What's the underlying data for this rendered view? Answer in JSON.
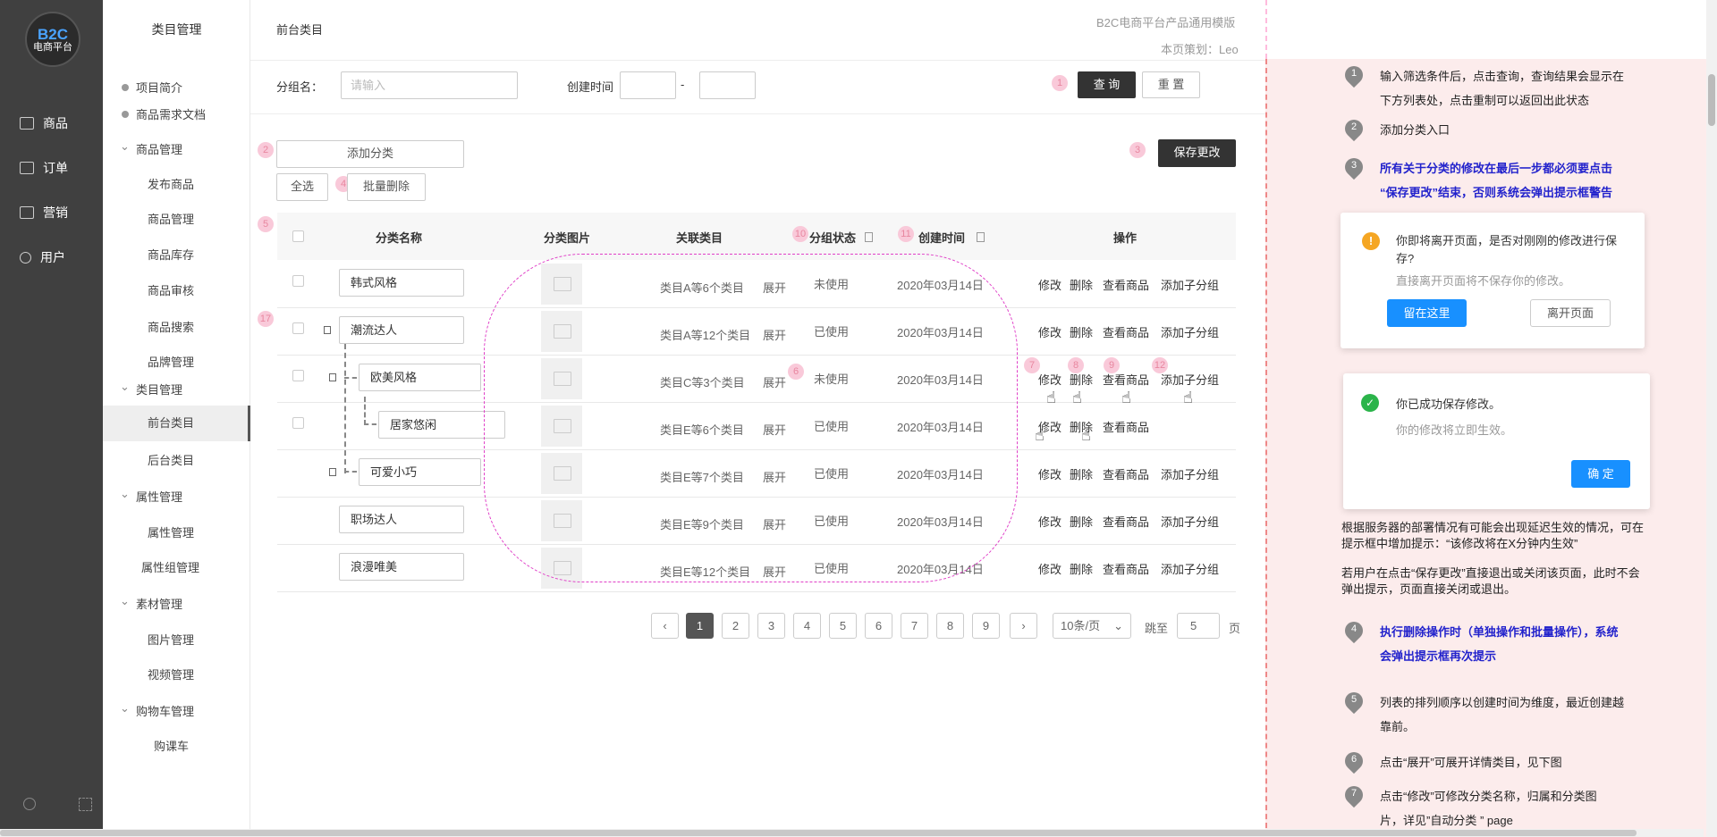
{
  "app": {
    "logo_top": "B2C",
    "logo_bottom": "电商平台"
  },
  "dark_nav": [
    {
      "label": "商品",
      "icon": "shopping-bag-icon"
    },
    {
      "label": "订单",
      "icon": "clipboard-icon"
    },
    {
      "label": "营销",
      "icon": "ticket-icon"
    },
    {
      "label": "用户",
      "icon": "user-icon"
    }
  ],
  "sidebar": {
    "title": "类目管理",
    "items": [
      {
        "label": "项目简介"
      },
      {
        "label": "商品需求文档"
      },
      {
        "label": "商品管理"
      },
      {
        "label": "发布商品"
      },
      {
        "label": "商品管理"
      },
      {
        "label": "商品库存"
      },
      {
        "label": "商品审核"
      },
      {
        "label": "商品搜索"
      },
      {
        "label": "品牌管理"
      },
      {
        "label": "类目管理"
      },
      {
        "label": "前台类目"
      },
      {
        "label": "后台类目"
      },
      {
        "label": "属性管理"
      },
      {
        "label": "属性管理"
      },
      {
        "label": "属性组管理"
      },
      {
        "label": "素材管理"
      },
      {
        "label": "图片管理"
      },
      {
        "label": "视频管理"
      },
      {
        "label": "购物车管理"
      },
      {
        "label": "购课车"
      }
    ]
  },
  "header": {
    "breadcrumb": "前台类目",
    "template": "B2C电商平台产品通用模版",
    "author": "本页策划：Leo"
  },
  "filter": {
    "group_label": "分组名：",
    "group_placeholder": "请输入",
    "time_label": "创建时间",
    "time_sep": "-",
    "query": "查 询",
    "reset": "重 置"
  },
  "actions": {
    "add": "添加分类",
    "save": "保存更改",
    "select_all": "全选",
    "batch_delete": "批量删除"
  },
  "table": {
    "headers": {
      "name": "分类名称",
      "image": "分类图片",
      "related": "关联类目",
      "status": "分组状态",
      "created": "创建时间",
      "ops": "操作"
    },
    "expand": "展开",
    "rows": [
      {
        "name": "韩式风格",
        "related": "类目A等6个类目",
        "status": "未使用",
        "created": "2020年03月14日"
      },
      {
        "name": "潮流达人",
        "related": "类目A等12个类目",
        "status": "已使用",
        "created": "2020年03月14日"
      },
      {
        "name": "欧美风格",
        "related": "类目C等3个类目",
        "status": "未使用",
        "created": "2020年03月14日"
      },
      {
        "name": "居家悠闲",
        "related": "类目E等6个类目",
        "status": "已使用",
        "created": "2020年03月14日"
      },
      {
        "name": "可爱小巧",
        "related": "类目E等7个类目",
        "status": "已使用",
        "created": "2020年03月14日"
      },
      {
        "name": "职场达人",
        "related": "类目E等9个类目",
        "status": "已使用",
        "created": "2020年03月14日"
      },
      {
        "name": "浪漫唯美",
        "related": "类目E等12个类目",
        "status": "已使用",
        "created": "2020年03月14日"
      }
    ],
    "ops": {
      "edit": "修改",
      "delete": "删除",
      "view": "查看商品",
      "add_child": "添加子分组"
    }
  },
  "pagination": {
    "pages": [
      "1",
      "2",
      "3",
      "4",
      "5",
      "6",
      "7",
      "8",
      "9"
    ],
    "current": "1",
    "page_size": "10条/页",
    "jump_label": "跳至",
    "jump_value": "5",
    "page_suffix": "页"
  },
  "pins": [
    "1",
    "2",
    "3",
    "4",
    "5",
    "17",
    "10",
    "11",
    "7",
    "8",
    "9",
    "12",
    "6"
  ],
  "notes": [
    {
      "num": "1",
      "text1": "输入筛选条件后，点击查询，查询结果会显示在",
      "text2": "下方列表处，点击重制可以返回出此状态"
    },
    {
      "num": "2",
      "text1": "添加分类入口"
    },
    {
      "num": "3",
      "text1": "所有关于分类的修改在最后一步都必须要点击",
      "text2": "“保存更改”结束，否则系统会弹出提示框警告"
    },
    {
      "num": "4",
      "text1": "执行删除操作时（单独操作和批量操作），系统",
      "text2": "会弹出提示框再次提示"
    },
    {
      "num": "5",
      "text1": "列表的排列顺序以创建时间为维度，最近创建越",
      "text2": "靠前。"
    },
    {
      "num": "6",
      "text1": "点击“展开”可展开详情类目，见下图"
    },
    {
      "num": "7",
      "text1": "点击“修改”可修改分类名称，归属和分类图",
      "text2": "片，详见”自动分类 ” page"
    }
  ],
  "dialog_leave": {
    "title": "你即将离开页面，是否对刚刚的修改进行保存?",
    "desc": "直接离开页面将不保存你的修改。",
    "stay": "留在这里",
    "leave": "离开页面"
  },
  "dialog_saved": {
    "title": "你已成功保存修改。",
    "desc": "你的修改将立即生效。",
    "ok": "确 定"
  },
  "para1": "根据服务器的部署情况有可能会出现延迟生效的情况，可在提示框中增加提示：“该修改将在X分钟内生效”",
  "para2": "若用户在点击“保存更改”直接退出或关闭该页面，此时不会弹出提示，页面直接关闭或退出。"
}
